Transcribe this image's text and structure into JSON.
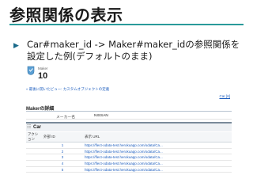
{
  "slide": {
    "title": "参照関係の表示",
    "bullet_text": "Car#maker_id -> Maker#maker_idの参照関係を設定した例(デフォルトのまま)"
  },
  "screenshot": {
    "maker_label": "Maker",
    "maker_count": "10",
    "back_link": "« 最後に開いたビュー: カスタムオブジェクトの定義",
    "top_right_link": "Car [6]",
    "detail_section_title": "Makerの詳細",
    "field_label": "メーカー名",
    "field_value": "NISSAN",
    "related_list": {
      "title": "Car",
      "columns": [
        "アクション",
        "外部 ID",
        "表示 URL"
      ],
      "rows": [
        {
          "id": "1",
          "url": "https://flect-odata-test.herokuapp.com/odata/Ca..."
        },
        {
          "id": "2",
          "url": "https://flect-odata-test.herokuapp.com/odata/Ca..."
        },
        {
          "id": "3",
          "url": "https://flect-odata-test.herokuapp.com/odata/Ca..."
        },
        {
          "id": "4",
          "url": "https://flect-odata-test.herokuapp.com/odata/Ca..."
        },
        {
          "id": "5",
          "url": "https://flect-odata-test.herokuapp.com/odata/Ca..."
        }
      ]
    }
  },
  "colors": {
    "accent_rule": "#2a9a9a",
    "link_blue": "#1f5fbf"
  }
}
